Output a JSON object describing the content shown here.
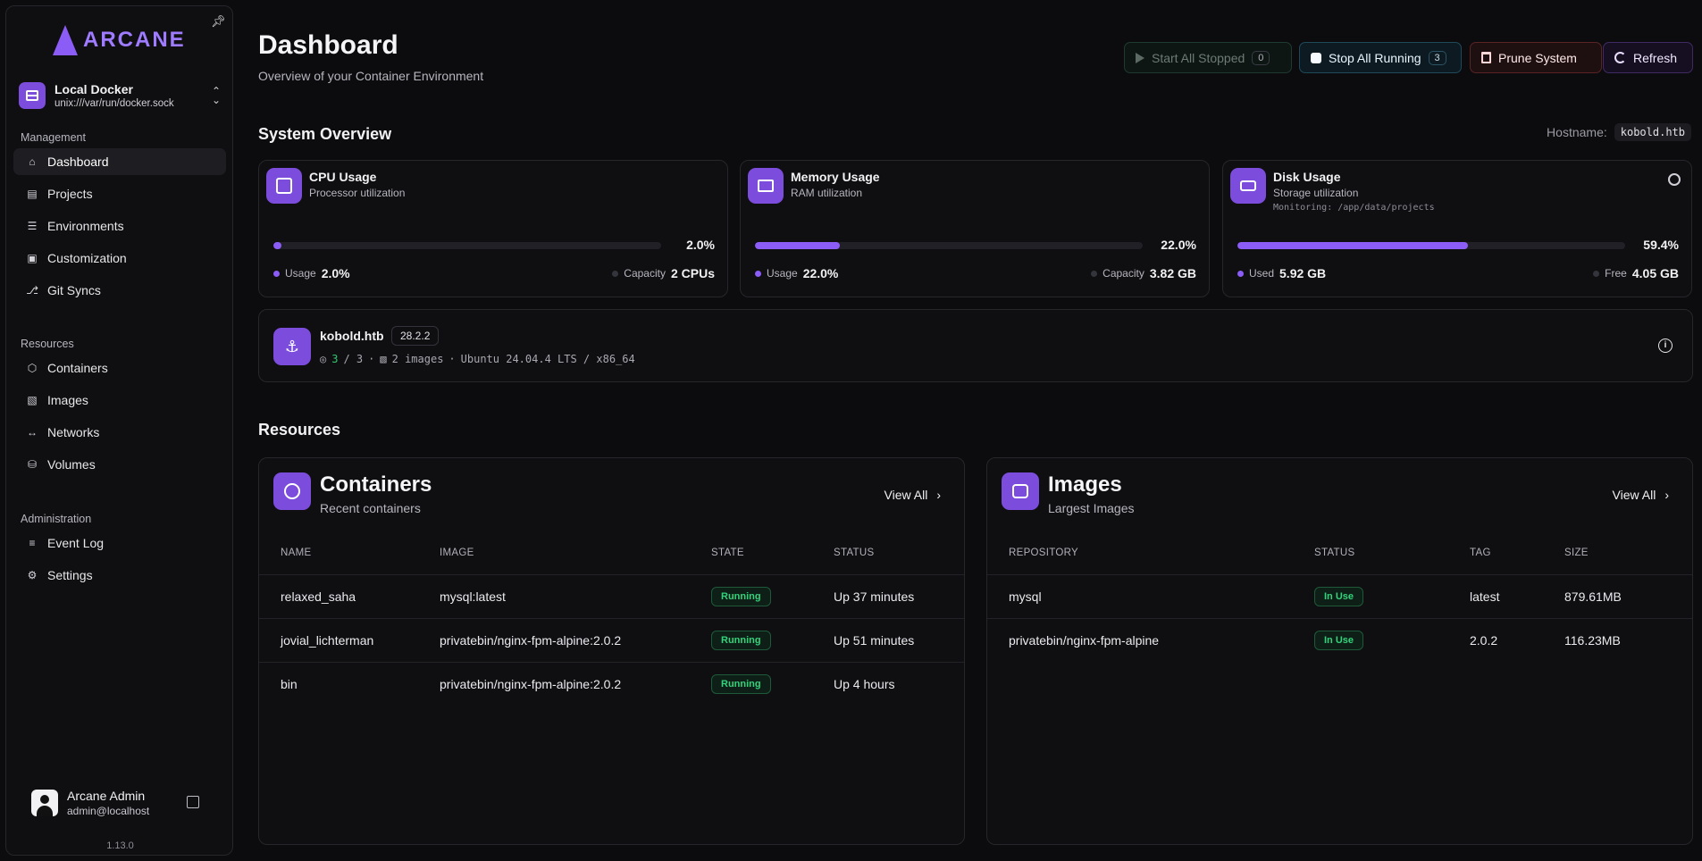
{
  "sidebar": {
    "logo": "ARCANE",
    "environment": {
      "name": "Local Docker",
      "socket": "unix:///var/run/docker.sock"
    },
    "sections": {
      "management": "Management",
      "resources": "Resources",
      "administration": "Administration"
    },
    "management_items": [
      {
        "label": "Dashboard",
        "icon": "home-icon"
      },
      {
        "label": "Projects",
        "icon": "file-icon"
      },
      {
        "label": "Environments",
        "icon": "server-icon"
      },
      {
        "label": "Customization",
        "icon": "palette-icon"
      },
      {
        "label": "Git Syncs",
        "icon": "git-branch-icon"
      }
    ],
    "resource_items": [
      {
        "label": "Containers",
        "icon": "container-icon"
      },
      {
        "label": "Images",
        "icon": "image-icon"
      },
      {
        "label": "Networks",
        "icon": "network-icon"
      },
      {
        "label": "Volumes",
        "icon": "database-icon"
      }
    ],
    "admin_items": [
      {
        "label": "Event Log",
        "icon": "list-icon"
      },
      {
        "label": "Settings",
        "icon": "gear-icon"
      }
    ],
    "user": {
      "name": "Arcane Admin",
      "email": "admin@localhost"
    },
    "version": "1.13.0"
  },
  "header": {
    "title": "Dashboard",
    "subtitle": "Overview of your Container Environment",
    "buttons": {
      "start_all_stopped": {
        "label": "Start All Stopped",
        "count": "0"
      },
      "stop_all_running": {
        "label": "Stop All Running",
        "count": "3"
      },
      "prune_system": {
        "label": "Prune System"
      },
      "refresh": {
        "label": "Refresh"
      }
    }
  },
  "overview": {
    "title": "System Overview",
    "hostname_label": "Hostname:",
    "hostname": "kobold.htb",
    "cpu": {
      "title": "CPU Usage",
      "subtitle": "Processor utilization",
      "percent": "2.0%",
      "fill": 0.02,
      "left_label": "Usage",
      "left_value": "2.0%",
      "right_label": "Capacity",
      "right_value": "2 CPUs"
    },
    "memory": {
      "title": "Memory Usage",
      "subtitle": "RAM utilization",
      "percent": "22.0%",
      "fill": 0.22,
      "left_label": "Usage",
      "left_value": "22.0%",
      "right_label": "Capacity",
      "right_value": "3.82 GB"
    },
    "disk": {
      "title": "Disk Usage",
      "subtitle": "Storage utilization",
      "monitoring": "Monitoring: /app/data/projects",
      "percent": "59.4%",
      "fill": 0.594,
      "left_label": "Used",
      "left_value": "5.92 GB",
      "right_label": "Free",
      "right_value": "4.05 GB"
    }
  },
  "host": {
    "name": "kobold.htb",
    "version": "28.2.2",
    "containers_running": "3",
    "containers_total": "/ 3",
    "images": "2 images",
    "os": "Ubuntu 24.04.4 LTS / x86_64"
  },
  "resources": {
    "title": "Resources",
    "containers": {
      "title": "Containers",
      "subtitle": "Recent containers",
      "view_all": "View All",
      "columns": [
        "NAME",
        "IMAGE",
        "STATE",
        "STATUS"
      ],
      "rows": [
        {
          "name": "relaxed_saha",
          "image": "mysql:latest",
          "state": "Running",
          "status": "Up 37 minutes"
        },
        {
          "name": "jovial_lichterman",
          "image": "privatebin/nginx-fpm-alpine:2.0.2",
          "state": "Running",
          "status": "Up 51 minutes"
        },
        {
          "name": "bin",
          "image": "privatebin/nginx-fpm-alpine:2.0.2",
          "state": "Running",
          "status": "Up 4 hours"
        }
      ]
    },
    "images": {
      "title": "Images",
      "subtitle": "Largest Images",
      "view_all": "View All",
      "columns": [
        "REPOSITORY",
        "STATUS",
        "TAG",
        "SIZE"
      ],
      "rows": [
        {
          "repository": "mysql",
          "status": "In Use",
          "tag": "latest",
          "size": "879.61MB"
        },
        {
          "repository": "privatebin/nginx-fpm-alpine",
          "status": "In Use",
          "tag": "2.0.2",
          "size": "116.23MB"
        }
      ]
    }
  },
  "colors": {
    "accent": "#8b5cf6",
    "running": "#34d37b",
    "background": "#0c0c0e"
  }
}
